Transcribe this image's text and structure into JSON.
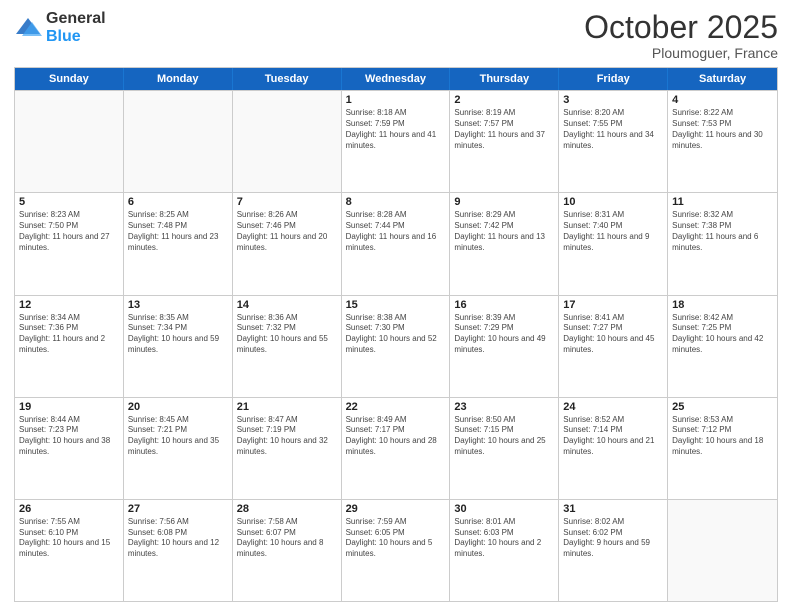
{
  "header": {
    "logo_general": "General",
    "logo_blue": "Blue",
    "month_title": "October 2025",
    "location": "Ploumoguer, France"
  },
  "days_of_week": [
    "Sunday",
    "Monday",
    "Tuesday",
    "Wednesday",
    "Thursday",
    "Friday",
    "Saturday"
  ],
  "weeks": [
    [
      {
        "day": "",
        "text": ""
      },
      {
        "day": "",
        "text": ""
      },
      {
        "day": "",
        "text": ""
      },
      {
        "day": "1",
        "text": "Sunrise: 8:18 AM\nSunset: 7:59 PM\nDaylight: 11 hours and 41 minutes."
      },
      {
        "day": "2",
        "text": "Sunrise: 8:19 AM\nSunset: 7:57 PM\nDaylight: 11 hours and 37 minutes."
      },
      {
        "day": "3",
        "text": "Sunrise: 8:20 AM\nSunset: 7:55 PM\nDaylight: 11 hours and 34 minutes."
      },
      {
        "day": "4",
        "text": "Sunrise: 8:22 AM\nSunset: 7:53 PM\nDaylight: 11 hours and 30 minutes."
      }
    ],
    [
      {
        "day": "5",
        "text": "Sunrise: 8:23 AM\nSunset: 7:50 PM\nDaylight: 11 hours and 27 minutes."
      },
      {
        "day": "6",
        "text": "Sunrise: 8:25 AM\nSunset: 7:48 PM\nDaylight: 11 hours and 23 minutes."
      },
      {
        "day": "7",
        "text": "Sunrise: 8:26 AM\nSunset: 7:46 PM\nDaylight: 11 hours and 20 minutes."
      },
      {
        "day": "8",
        "text": "Sunrise: 8:28 AM\nSunset: 7:44 PM\nDaylight: 11 hours and 16 minutes."
      },
      {
        "day": "9",
        "text": "Sunrise: 8:29 AM\nSunset: 7:42 PM\nDaylight: 11 hours and 13 minutes."
      },
      {
        "day": "10",
        "text": "Sunrise: 8:31 AM\nSunset: 7:40 PM\nDaylight: 11 hours and 9 minutes."
      },
      {
        "day": "11",
        "text": "Sunrise: 8:32 AM\nSunset: 7:38 PM\nDaylight: 11 hours and 6 minutes."
      }
    ],
    [
      {
        "day": "12",
        "text": "Sunrise: 8:34 AM\nSunset: 7:36 PM\nDaylight: 11 hours and 2 minutes."
      },
      {
        "day": "13",
        "text": "Sunrise: 8:35 AM\nSunset: 7:34 PM\nDaylight: 10 hours and 59 minutes."
      },
      {
        "day": "14",
        "text": "Sunrise: 8:36 AM\nSunset: 7:32 PM\nDaylight: 10 hours and 55 minutes."
      },
      {
        "day": "15",
        "text": "Sunrise: 8:38 AM\nSunset: 7:30 PM\nDaylight: 10 hours and 52 minutes."
      },
      {
        "day": "16",
        "text": "Sunrise: 8:39 AM\nSunset: 7:29 PM\nDaylight: 10 hours and 49 minutes."
      },
      {
        "day": "17",
        "text": "Sunrise: 8:41 AM\nSunset: 7:27 PM\nDaylight: 10 hours and 45 minutes."
      },
      {
        "day": "18",
        "text": "Sunrise: 8:42 AM\nSunset: 7:25 PM\nDaylight: 10 hours and 42 minutes."
      }
    ],
    [
      {
        "day": "19",
        "text": "Sunrise: 8:44 AM\nSunset: 7:23 PM\nDaylight: 10 hours and 38 minutes."
      },
      {
        "day": "20",
        "text": "Sunrise: 8:45 AM\nSunset: 7:21 PM\nDaylight: 10 hours and 35 minutes."
      },
      {
        "day": "21",
        "text": "Sunrise: 8:47 AM\nSunset: 7:19 PM\nDaylight: 10 hours and 32 minutes."
      },
      {
        "day": "22",
        "text": "Sunrise: 8:49 AM\nSunset: 7:17 PM\nDaylight: 10 hours and 28 minutes."
      },
      {
        "day": "23",
        "text": "Sunrise: 8:50 AM\nSunset: 7:15 PM\nDaylight: 10 hours and 25 minutes."
      },
      {
        "day": "24",
        "text": "Sunrise: 8:52 AM\nSunset: 7:14 PM\nDaylight: 10 hours and 21 minutes."
      },
      {
        "day": "25",
        "text": "Sunrise: 8:53 AM\nSunset: 7:12 PM\nDaylight: 10 hours and 18 minutes."
      }
    ],
    [
      {
        "day": "26",
        "text": "Sunrise: 7:55 AM\nSunset: 6:10 PM\nDaylight: 10 hours and 15 minutes."
      },
      {
        "day": "27",
        "text": "Sunrise: 7:56 AM\nSunset: 6:08 PM\nDaylight: 10 hours and 12 minutes."
      },
      {
        "day": "28",
        "text": "Sunrise: 7:58 AM\nSunset: 6:07 PM\nDaylight: 10 hours and 8 minutes."
      },
      {
        "day": "29",
        "text": "Sunrise: 7:59 AM\nSunset: 6:05 PM\nDaylight: 10 hours and 5 minutes."
      },
      {
        "day": "30",
        "text": "Sunrise: 8:01 AM\nSunset: 6:03 PM\nDaylight: 10 hours and 2 minutes."
      },
      {
        "day": "31",
        "text": "Sunrise: 8:02 AM\nSunset: 6:02 PM\nDaylight: 9 hours and 59 minutes."
      },
      {
        "day": "",
        "text": ""
      }
    ]
  ]
}
